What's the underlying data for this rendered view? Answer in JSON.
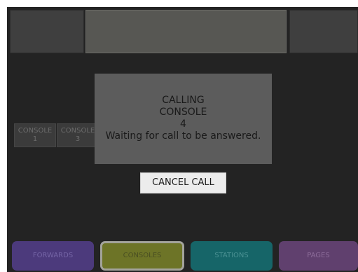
{
  "dialog": {
    "line1": "CALLING",
    "line2": "CONSOLE",
    "line3": "4",
    "line4": "Waiting for call to be answered."
  },
  "cancel_button": {
    "label": "CANCEL CALL"
  },
  "consoles": [
    {
      "label": "CONSOLE",
      "number": "1"
    },
    {
      "label": "CONSOLE",
      "number": "3"
    }
  ],
  "nav_tabs": [
    {
      "label": "FORWARDS",
      "color": "#4c3a7c"
    },
    {
      "label": "CONSOLES",
      "color": "#6d7427",
      "selected": true
    },
    {
      "label": "STATIONS",
      "color": "#166568"
    },
    {
      "label": "PAGES",
      "color": "#60406e"
    }
  ]
}
